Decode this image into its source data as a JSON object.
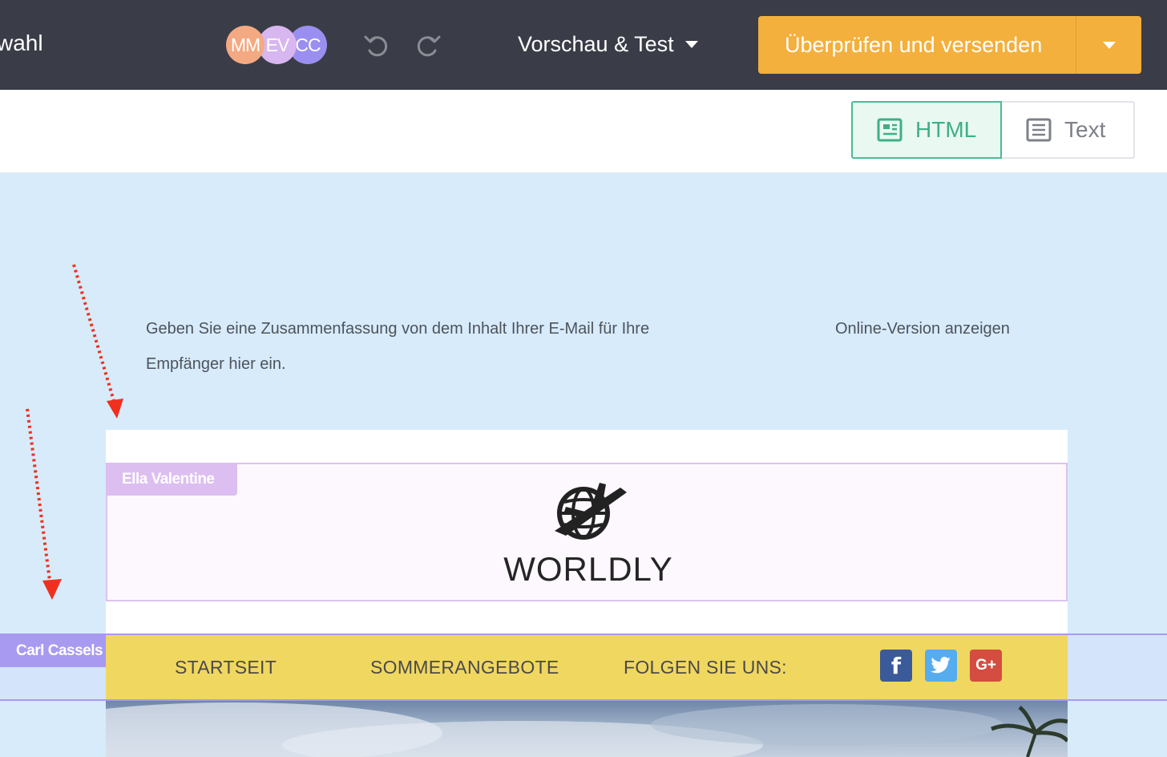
{
  "topbar": {
    "breadcrumb_fragment": "wahl",
    "avatars": [
      {
        "initials": "MM",
        "color": "#f3a982"
      },
      {
        "initials": "EV",
        "color": "#d8b6f0"
      },
      {
        "initials": "CC",
        "color": "#9a8ff0"
      }
    ],
    "preview_label": "Vorschau & Test",
    "send_label": "Überprüfen und versenden",
    "accent_color": "#f3b03d"
  },
  "subbar": {
    "html_label": "HTML",
    "text_label": "Text",
    "active_mode": "HTML"
  },
  "email": {
    "summary_text": "Geben Sie eine Zusammenfassung von dem Inhalt Ihrer E-Mail für Ihre Empfänger hier ein.",
    "online_version_link": "Online-Version anzeigen",
    "logo_text": "WORLDLY",
    "nav": {
      "items": [
        "STARTSEIT",
        "SOMMERANGEBOTE",
        "FOLGEN SIE UNS:"
      ],
      "social": [
        {
          "icon": "facebook-icon",
          "glyph": "f",
          "color": "#3b5a9a"
        },
        {
          "icon": "twitter-icon",
          "glyph": "t",
          "color": "#55acee"
        },
        {
          "icon": "google-plus-icon",
          "glyph": "G+",
          "color": "#d44d40"
        }
      ]
    }
  },
  "collaborators": {
    "ella_label": "Ella Valentine",
    "carl_label": "Carl Cassels"
  }
}
